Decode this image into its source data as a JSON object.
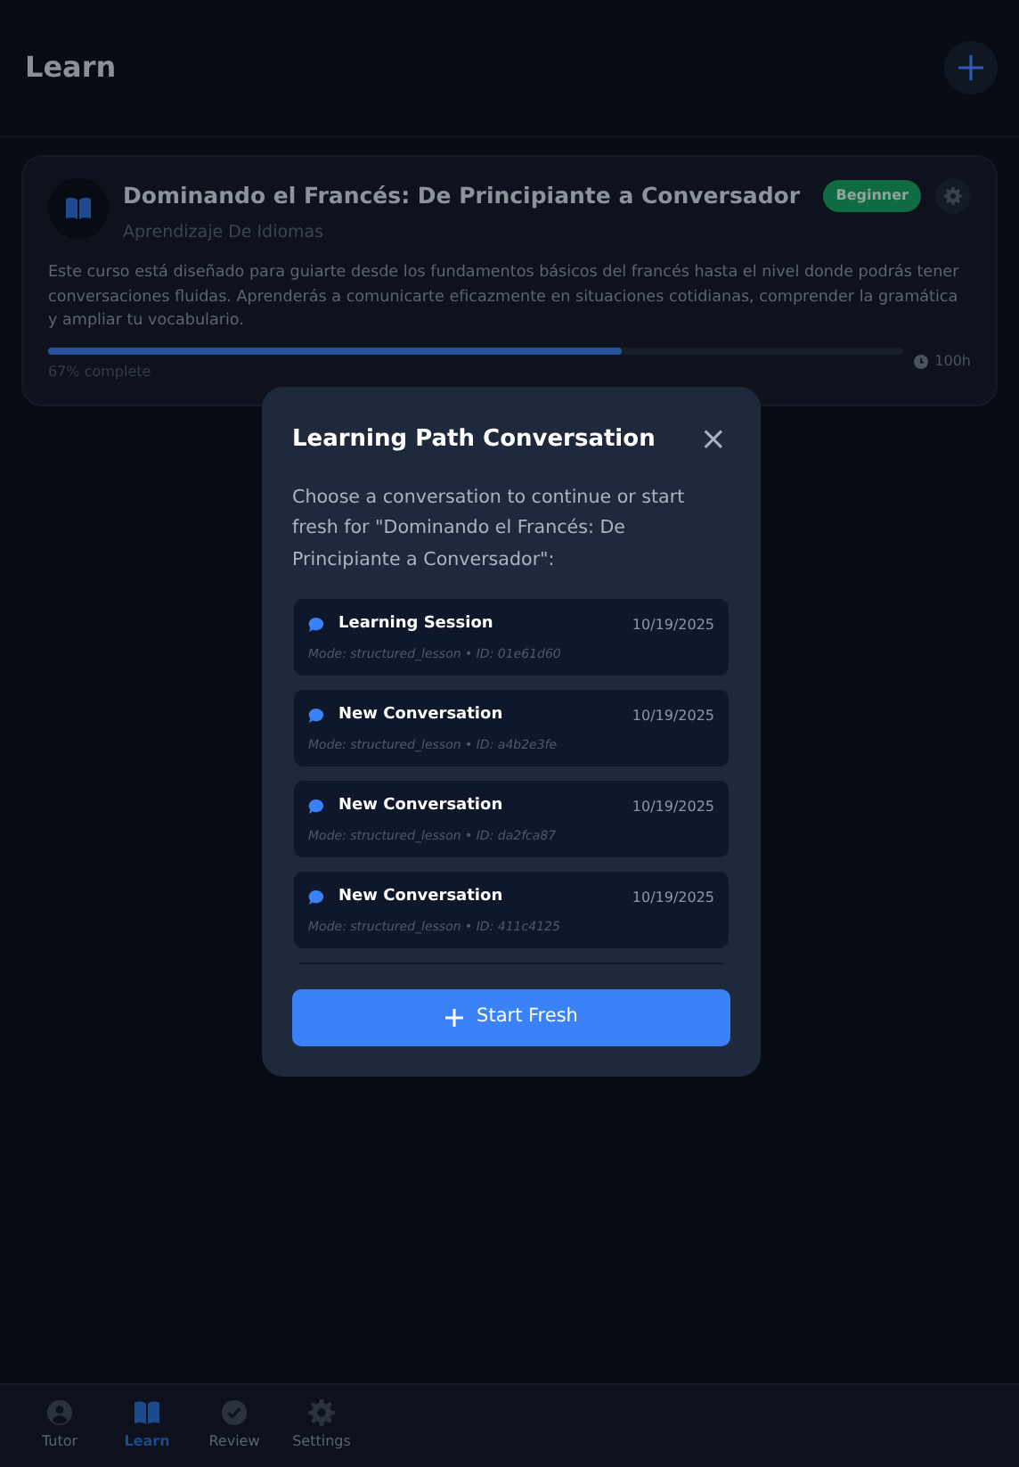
{
  "header": {
    "title": "Learn"
  },
  "course": {
    "title": "Dominando el Francés: De Principiante a Conversador",
    "category": "Aprendizaje De Idiomas",
    "level_badge": "Beginner",
    "description": "Este curso está diseñado para guiarte desde los fundamentos básicos del francés hasta el nivel donde podrás tener conversaciones fluidas. Aprenderás a comunicarte eficazmente en situaciones cotidianas, comprender la gramática y ampliar tu vocabulario.",
    "progress": {
      "level": 0.67,
      "label": "67% complete"
    },
    "duration": "100h"
  },
  "modal": {
    "title": "Learning Path Conversation",
    "close": "×",
    "message": "Choose a conversation to continue or start fresh for \"Dominando el Francés: De Principiante a Conversador\":",
    "conversations": [
      {
        "title": "Learning Session",
        "date": "10/19/2025",
        "meta": "Mode: structured_lesson • ID: 01e61d60"
      },
      {
        "title": "New Conversation",
        "date": "10/19/2025",
        "meta": "Mode: structured_lesson • ID: a4b2e3fe"
      },
      {
        "title": "New Conversation",
        "date": "10/19/2025",
        "meta": "Mode: structured_lesson • ID: da2fca87"
      },
      {
        "title": "New Conversation",
        "date": "10/19/2025",
        "meta": "Mode: structured_lesson • ID: 411c4125"
      }
    ],
    "button": "Start Fresh"
  },
  "nav": [
    {
      "label": "Tutor",
      "kind": "person",
      "selected": false
    },
    {
      "label": "Learn",
      "kind": "book",
      "selected": true
    },
    {
      "label": "Review",
      "kind": "check",
      "selected": false
    },
    {
      "label": "Settings",
      "kind": "gear",
      "selected": false
    }
  ]
}
